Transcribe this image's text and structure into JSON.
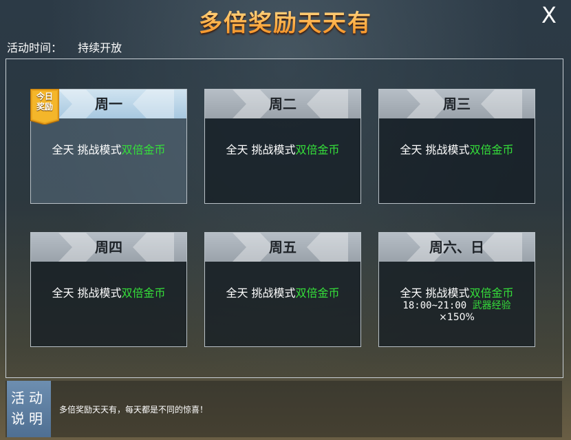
{
  "title": "多倍奖励天天有",
  "close_label": "X",
  "activity_time": {
    "label": "活动时间：",
    "value": "持续开放"
  },
  "badge": {
    "line1": "今日",
    "line2": "奖励"
  },
  "cards": [
    {
      "day": "周一",
      "prefix": "全天  挑战模式",
      "highlight": "双倍金币",
      "today": true
    },
    {
      "day": "周二",
      "prefix": "全天  挑战模式",
      "highlight": "双倍金币"
    },
    {
      "day": "周三",
      "prefix": "全天  挑战模式",
      "highlight": "双倍金币"
    },
    {
      "day": "周四",
      "prefix": "全天  挑战模式",
      "highlight": "双倍金币"
    },
    {
      "day": "周五",
      "prefix": "全天  挑战模式",
      "highlight": "双倍金币"
    },
    {
      "day": "周六、日",
      "prefix": "全天  挑战模式",
      "highlight": "双倍金币",
      "extra_time": "18:00~21:00 ",
      "extra_highlight": "武器经验",
      "extra_mult": "×150%"
    }
  ],
  "footer": {
    "button_line1": "活动",
    "button_line2": "说明",
    "text": "多倍奖励天天有，每天都是不同的惊喜！"
  },
  "colors": {
    "title": "#ffb24a",
    "highlight": "#35e03a",
    "footer_button": "#5a7ca0"
  }
}
